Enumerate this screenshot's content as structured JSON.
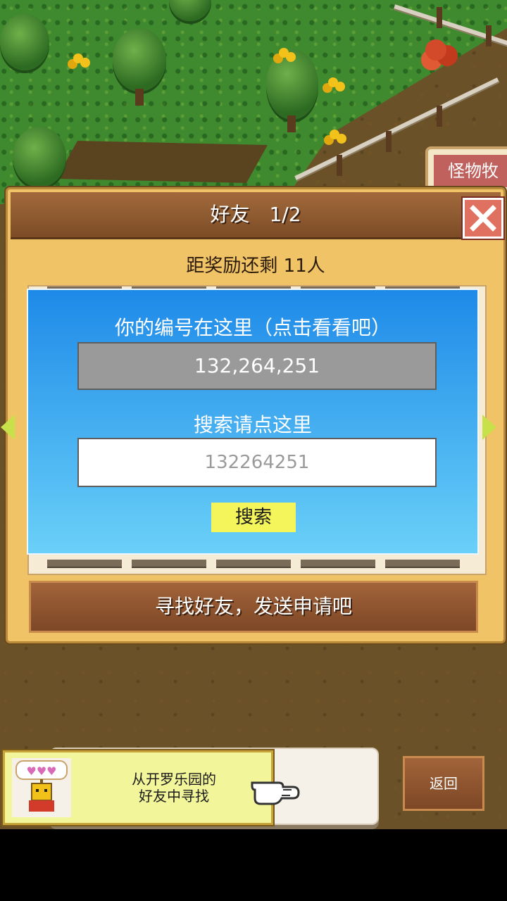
{
  "background": {
    "sign_label": "怪物牧"
  },
  "dialog": {
    "title": "好友　1/2",
    "reward_text": "距奖励还剩 11人",
    "my_id_caption": "你的编号在这里（点击看看吧）",
    "my_id_value": "132,264,251",
    "search_caption": "搜索请点这里",
    "search_placeholder": "132264251",
    "search_button": "搜索",
    "find_friends_button": "寻找好友，发送申请吧"
  },
  "bottom": {
    "cairo_friends_line1": "从开罗乐园的",
    "cairo_friends_line2": "好友中寻找",
    "back_button": "返回"
  },
  "colors": {
    "accent_blue": "#1e8ae8",
    "search_button": "#f3f55a",
    "close_button": "#e07060"
  }
}
